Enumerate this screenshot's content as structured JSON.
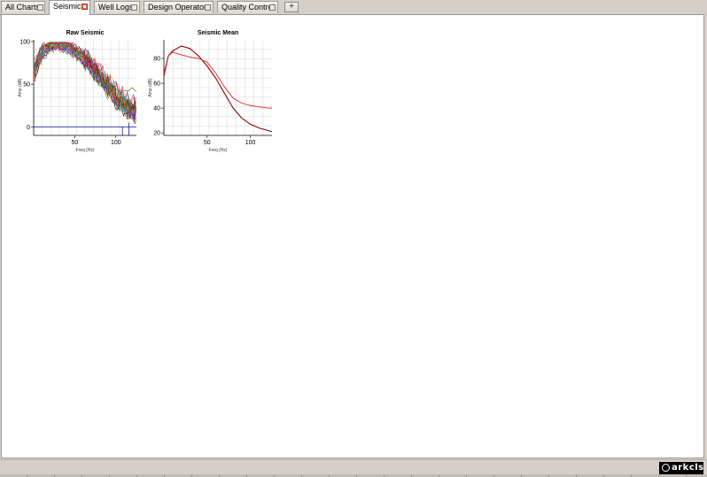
{
  "tabs": [
    {
      "label": "All Charts",
      "active": false
    },
    {
      "label": "Seismic",
      "active": true
    },
    {
      "label": "Well Logs",
      "active": false
    },
    {
      "label": "Design Operators",
      "active": false
    },
    {
      "label": "Quality Control",
      "active": false
    }
  ],
  "add_tab_label": "+",
  "logo_text": "arkcls",
  "chart_data": [
    {
      "type": "line",
      "title": "Raw Seismic",
      "xlabel": "Freq (Hz)",
      "ylabel": "Amp (dB)",
      "xlim": [
        0,
        125
      ],
      "ylim": [
        -10,
        102
      ],
      "xticks": [
        50,
        100
      ],
      "yticks": [
        0,
        50,
        100
      ],
      "grid": true,
      "series_colors": [
        "#1a3fd6",
        "#e11e1e",
        "#0a9b0a",
        "#e6c800",
        "#8a2be2",
        "#00b5c8",
        "#ff7f00",
        "#b8007a",
        "#2f7f2f",
        "#7a0000"
      ],
      "series": [
        {
          "x": [
            0,
            10,
            20,
            30,
            40,
            50,
            60,
            70,
            80,
            90,
            100,
            110,
            120,
            125
          ],
          "y": [
            66,
            90,
            96,
            98,
            96,
            92,
            84,
            74,
            64,
            52,
            38,
            28,
            22,
            20
          ]
        },
        {
          "x": [
            0,
            10,
            20,
            30,
            40,
            50,
            60,
            70,
            80,
            90,
            100,
            110,
            120,
            125
          ],
          "y": [
            60,
            86,
            94,
            96,
            94,
            88,
            80,
            70,
            58,
            46,
            32,
            24,
            18,
            16
          ]
        },
        {
          "x": [
            0,
            10,
            20,
            30,
            40,
            50,
            60,
            70,
            80,
            90,
            100,
            110,
            120,
            125
          ],
          "y": [
            72,
            92,
            98,
            99,
            97,
            93,
            86,
            76,
            66,
            56,
            44,
            34,
            28,
            26
          ]
        },
        {
          "x": [
            0,
            10,
            20,
            30,
            40,
            50,
            60,
            70,
            80,
            90,
            100,
            110,
            120,
            125
          ],
          "y": [
            55,
            82,
            92,
            95,
            92,
            86,
            78,
            68,
            56,
            44,
            30,
            22,
            15,
            12
          ]
        },
        {
          "x": [
            0,
            10,
            20,
            30,
            40,
            50,
            60,
            70,
            80,
            90,
            100,
            110,
            120,
            125
          ],
          "y": [
            68,
            88,
            95,
            97,
            95,
            90,
            82,
            72,
            60,
            50,
            36,
            26,
            20,
            18
          ]
        }
      ],
      "outlier": {
        "x": [
          70,
          80,
          85,
          90,
          95,
          100,
          105,
          110,
          115,
          120,
          125
        ],
        "y": [
          60,
          50,
          46,
          48,
          42,
          45,
          40,
          43,
          42,
          46,
          41
        ]
      },
      "baseline": {
        "y": 0
      }
    },
    {
      "type": "line",
      "title": "Seismic Mean",
      "xlabel": "Freq (Hz)",
      "ylabel": "Amp (dB)",
      "xlim": [
        0,
        125
      ],
      "ylim": [
        18,
        95
      ],
      "xticks": [
        50,
        100
      ],
      "yticks": [
        20,
        40,
        60,
        80
      ],
      "grid": true,
      "series": [
        {
          "color": "#8a0000",
          "x": [
            0,
            5,
            10,
            15,
            20,
            25,
            30,
            35,
            40,
            50,
            60,
            70,
            80,
            90,
            100,
            110,
            120,
            125
          ],
          "y": [
            66,
            82,
            86,
            88,
            90,
            89,
            88,
            85,
            82,
            74,
            64,
            52,
            40,
            32,
            27,
            24,
            22,
            21
          ]
        },
        {
          "color": "#e02020",
          "x": [
            0,
            5,
            10,
            20,
            30,
            40,
            50,
            60,
            70,
            80,
            90,
            100,
            110,
            120,
            125
          ],
          "y": [
            68,
            82,
            85,
            83,
            81,
            80,
            77,
            68,
            57,
            48,
            44,
            42,
            41,
            40,
            40
          ]
        }
      ]
    }
  ]
}
